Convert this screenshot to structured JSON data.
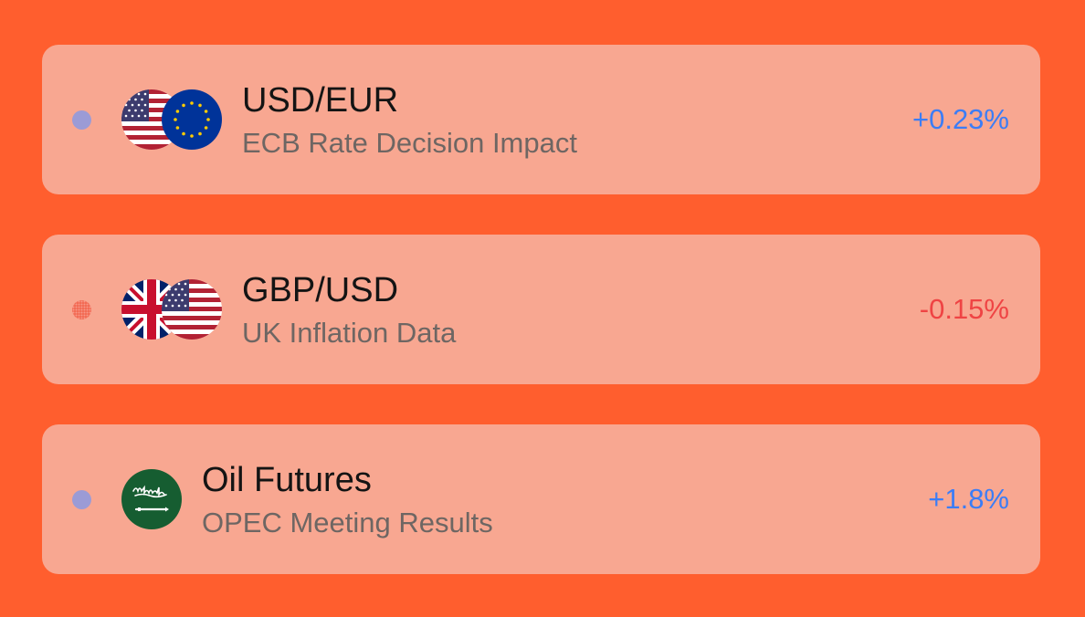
{
  "colors": {
    "background": "#ff5e2e",
    "card": "#f8a791",
    "positive": "#3b7df6",
    "negative": "#ef4444",
    "dot_default": "#9b9bd6",
    "dot_negative": "#f2624a"
  },
  "items": [
    {
      "title": "USD/EUR",
      "subtitle": "ECB Rate Decision Impact",
      "change": "+0.23%",
      "direction": "positive",
      "flags": [
        "us-flag-icon",
        "eu-flag-icon"
      ]
    },
    {
      "title": "GBP/USD",
      "subtitle": "UK Inflation Data",
      "change": "-0.15%",
      "direction": "negative",
      "flags": [
        "uk-flag-icon",
        "us-flag-icon"
      ]
    },
    {
      "title": "Oil Futures",
      "subtitle": "OPEC Meeting Results",
      "change": "+1.8%",
      "direction": "positive",
      "flags": [
        "saudi-flag-icon"
      ]
    }
  ]
}
